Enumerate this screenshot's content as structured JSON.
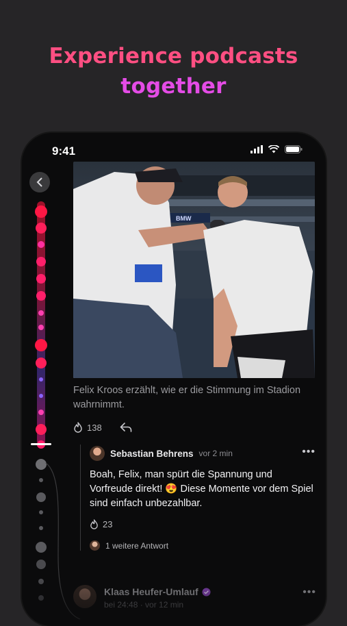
{
  "headline": {
    "line1": "Experience podcasts",
    "line2": "together"
  },
  "status_bar": {
    "time": "9:41"
  },
  "post": {
    "caption": "Felix Kroos erzählt, wie er die Stimmung im Stadion wahrnimmt.",
    "reaction_count": "138"
  },
  "comment": {
    "author": "Sebastian Behrens",
    "time": "vor 2 min",
    "text": "Boah, Felix, man spürt die Spannung und Vorfreude direkt! 😍 Diese Momente vor dem Spiel sind einfach unbezahlbar.",
    "reaction_count": "23",
    "replies_label": "1 weitere Antwort"
  },
  "comment2": {
    "author": "Klaas Heufer-Umlauf",
    "time": "bei 24:48 · vor 12 min"
  },
  "colors": {
    "accent_pink": "#ff4f82",
    "accent_magenta": "#e44ce6",
    "timeline_red": "#ff1744"
  }
}
